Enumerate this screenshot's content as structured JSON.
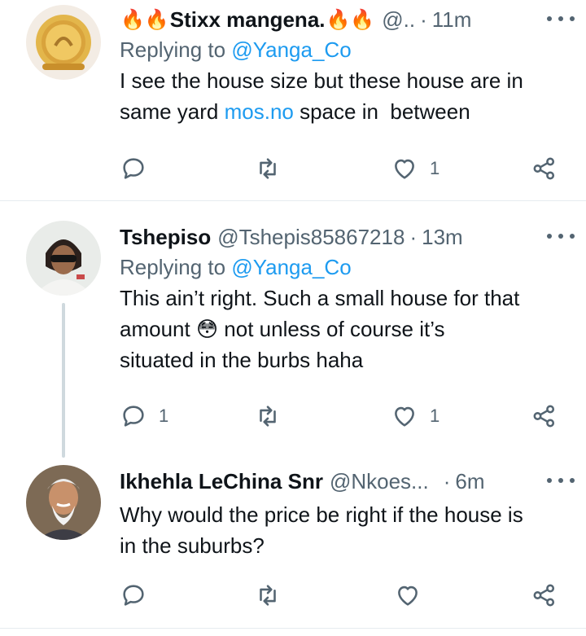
{
  "tweets": [
    {
      "name": "Stixx mangena.",
      "name_emoji_left": "🔥🔥",
      "name_emoji_right": "🔥🔥",
      "handle": "@..",
      "dot": "·",
      "time": "11m",
      "replying_prefix": "Replying to",
      "replying_to": "@Yanga_Co",
      "text_lines": [
        "I see the house size but these house are in",
        "same yard "
      ],
      "link_text": "mos.no",
      "text_after_link": " space in  between",
      "reply_count": "",
      "retweet_count": "",
      "like_count": "1"
    },
    {
      "name": "Tshepiso",
      "handle": "@Tshepis85867218",
      "dot": "·",
      "time": "13m",
      "replying_prefix": "Replying to",
      "replying_to": "@Yanga_Co",
      "line1": "This ain’t right. Such a small house for that",
      "line2_before": "amount ",
      "line2_emoji": "😳",
      "line2_after": " not unless of course it’s",
      "line3": "situated in the burbs haha",
      "reply_count": "1",
      "retweet_count": "",
      "like_count": "1"
    },
    {
      "name": "Ikhehla LeChina Snr",
      "handle": "@Nkoes...",
      "dot": "·",
      "time": "6m",
      "line1": "Why would the price be right if the house is",
      "line2": "in the suburbs?",
      "reply_count": "",
      "retweet_count": "",
      "like_count": ""
    }
  ],
  "icons": {
    "reply": "reply-icon",
    "retweet": "retweet-icon",
    "like": "heart-icon",
    "share": "share-icon",
    "more": "more-icon"
  },
  "colors": {
    "text": "#0f1419",
    "secondary": "#536471",
    "link": "#1d9bf0",
    "divider": "#e6ecf0",
    "thread": "#cfd9de"
  }
}
